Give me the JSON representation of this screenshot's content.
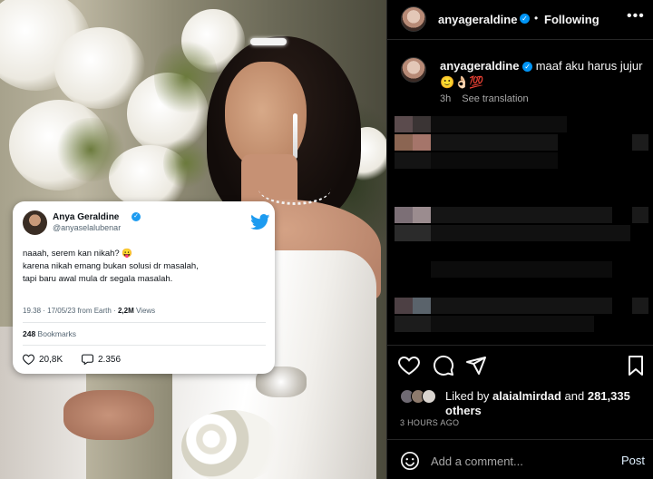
{
  "tweet": {
    "display_name": "Anya Geraldine",
    "handle": "@anyaselalubenar",
    "lines": [
      "naaah, serem kan nikah? 😛",
      "karena nikah emang bukan solusi dr masalah,",
      "tapi baru awal mula dr segala masalah."
    ],
    "timestamp": "19.38 · 17/05/23 from Earth · ",
    "views_count": "2,2M",
    "views_label": " Views",
    "bookmarks_count": "248",
    "bookmarks_label": " Bookmarks",
    "likes": "20,8K",
    "replies": "2.356",
    "brand_color": "#1d9bf0"
  },
  "header": {
    "username": "anyageraldine",
    "separator": "•",
    "follow_state": "Following",
    "more_icon": "more-options-icon"
  },
  "caption": {
    "username": "anyageraldine",
    "text": " maaf aku harus jujur 🙂👌🏻💯",
    "age": "3h",
    "see_translation": "See translation"
  },
  "likes": {
    "prefix": "Liked by ",
    "user": "alaialmirdad",
    "middle": " and ",
    "count": "281,335",
    "suffix": " others"
  },
  "post_time": "3 HOURS AGO",
  "comment": {
    "placeholder": "Add a comment...",
    "post_label": "Post"
  },
  "colors": {
    "panel_bg": "#000000",
    "text_primary": "#f5f5f5",
    "text_secondary": "#a8a8a8",
    "verified_blue": "#0095f6"
  }
}
